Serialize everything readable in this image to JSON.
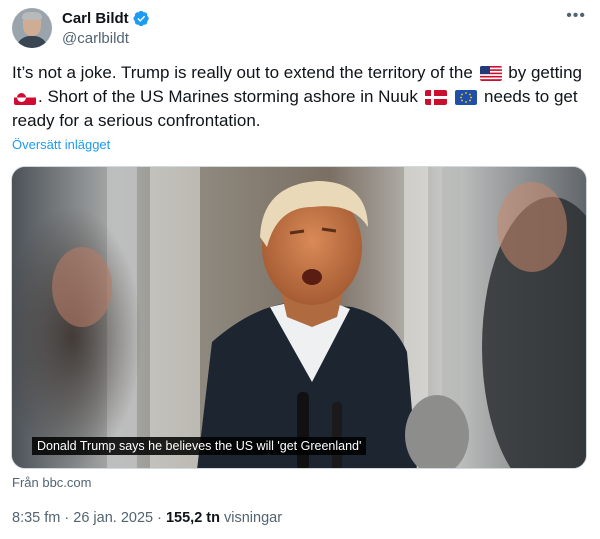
{
  "author": {
    "display_name": "Carl Bildt",
    "handle": "@carlbildt",
    "verified": true,
    "avatar_icon": "profile-photo"
  },
  "more_icon": "more-options-icon",
  "tweet": {
    "part1": "It’s not a joke. Trump is really out to extend the territory of the",
    "part2": " by getting",
    "part3": ". Short of the US Marines storming ashore in Nuuk",
    "part4": " needs to get ready for a serious confrontation.",
    "flags": [
      "us-flag",
      "greenland-flag",
      "denmark-flag",
      "eu-flag"
    ]
  },
  "translate_link": "Översätt inlägget",
  "media": {
    "caption": "Donald Trump says he believes the US will 'get Greenland'",
    "source": "Från bbc.com"
  },
  "meta": {
    "time": "8:35 fm",
    "separator1": " · ",
    "date": "26 jan. 2025",
    "separator2": " · ",
    "views_count": "155,2 tn",
    "views_label": " visningar"
  },
  "colors": {
    "link": "#1d9bf0",
    "secondary_text": "#536471",
    "primary_text": "#0f1419"
  }
}
